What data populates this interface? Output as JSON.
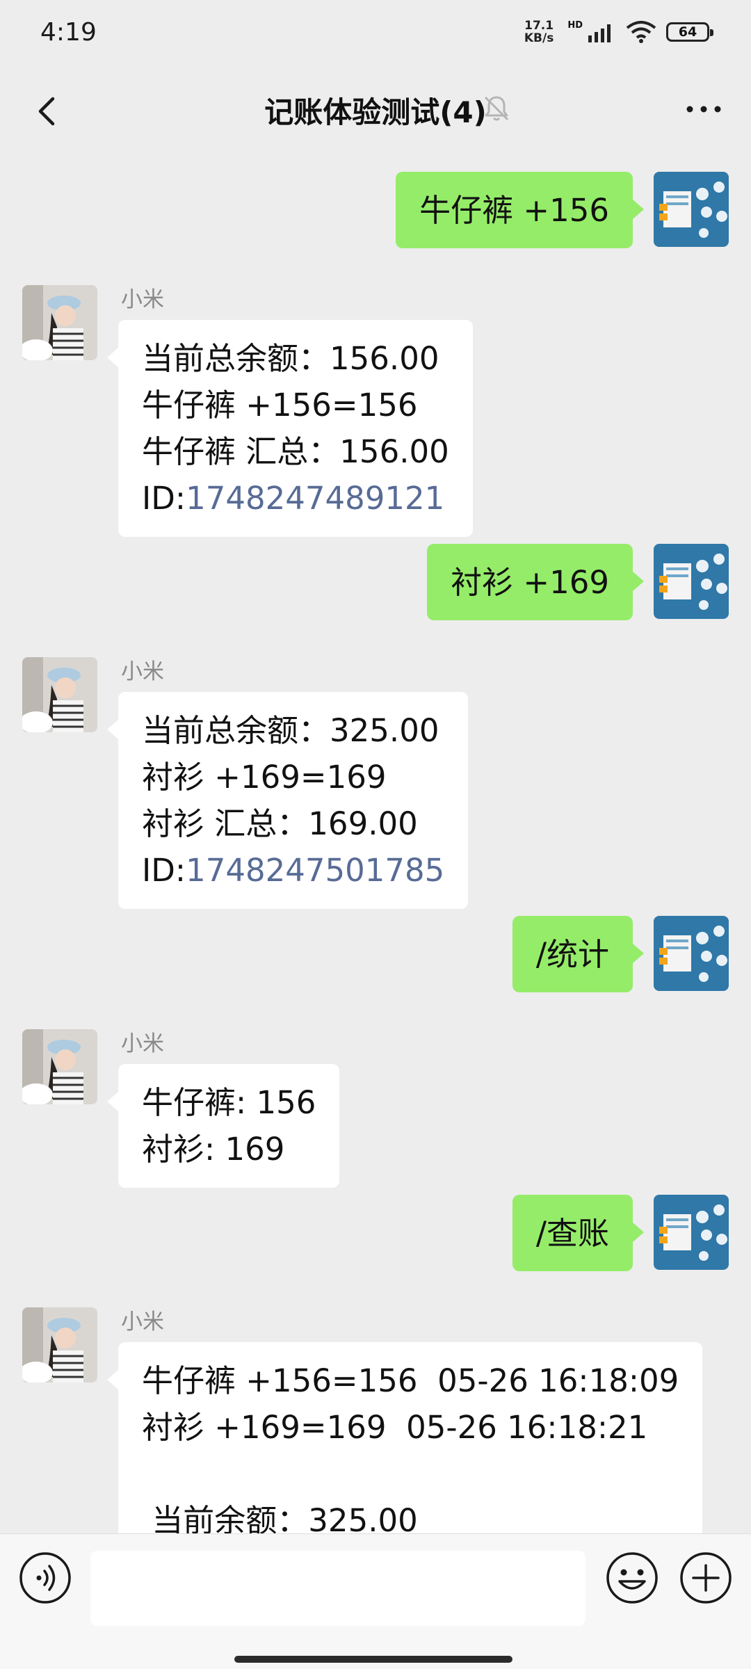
{
  "status_bar": {
    "time": "4:19",
    "speed_value": "17.1",
    "speed_unit": "KB/s",
    "network_badge": "HD",
    "battery": "64",
    "icons": [
      "signal-icon",
      "wifi-icon",
      "battery-icon"
    ]
  },
  "header": {
    "title": "记账体验测试(4)",
    "icons": [
      "back-icon",
      "mute-icon",
      "more-icon"
    ]
  },
  "messages": [
    {
      "direction": "out",
      "lines": [
        "牛仔裤 +156"
      ]
    },
    {
      "direction": "in",
      "sender": "小米",
      "lines": [
        "当前总余额：156.00",
        "牛仔裤 +156=156",
        "牛仔裤 汇总：156.00"
      ],
      "id_prefix": "ID:",
      "id_value": "1748247489121"
    },
    {
      "direction": "out",
      "lines": [
        "衬衫 +169"
      ]
    },
    {
      "direction": "in",
      "sender": "小米",
      "lines": [
        "当前总余额：325.00",
        "衬衫 +169=169",
        "衬衫 汇总：169.00"
      ],
      "id_prefix": "ID:",
      "id_value": "1748247501785"
    },
    {
      "direction": "out",
      "lines": [
        "/统计"
      ]
    },
    {
      "direction": "in",
      "sender": "小米",
      "lines": [
        "牛仔裤: 156",
        "衬衫: 169"
      ]
    },
    {
      "direction": "out",
      "lines": [
        "/查账"
      ]
    },
    {
      "direction": "in",
      "sender": "小米",
      "lines": [
        "牛仔裤 +156=156  05-26 16:18:09",
        "衬衫 +169=169  05-26 16:18:21",
        "",
        " 当前余额：325.00"
      ]
    }
  ],
  "input_bar": {
    "value": "",
    "icons": [
      "voice-icon",
      "emoji-icon",
      "plus-icon"
    ]
  },
  "colors": {
    "background": "#ededed",
    "outgoing_bubble": "#95ec69",
    "incoming_bubble": "#ffffff",
    "link": "#576b95"
  }
}
